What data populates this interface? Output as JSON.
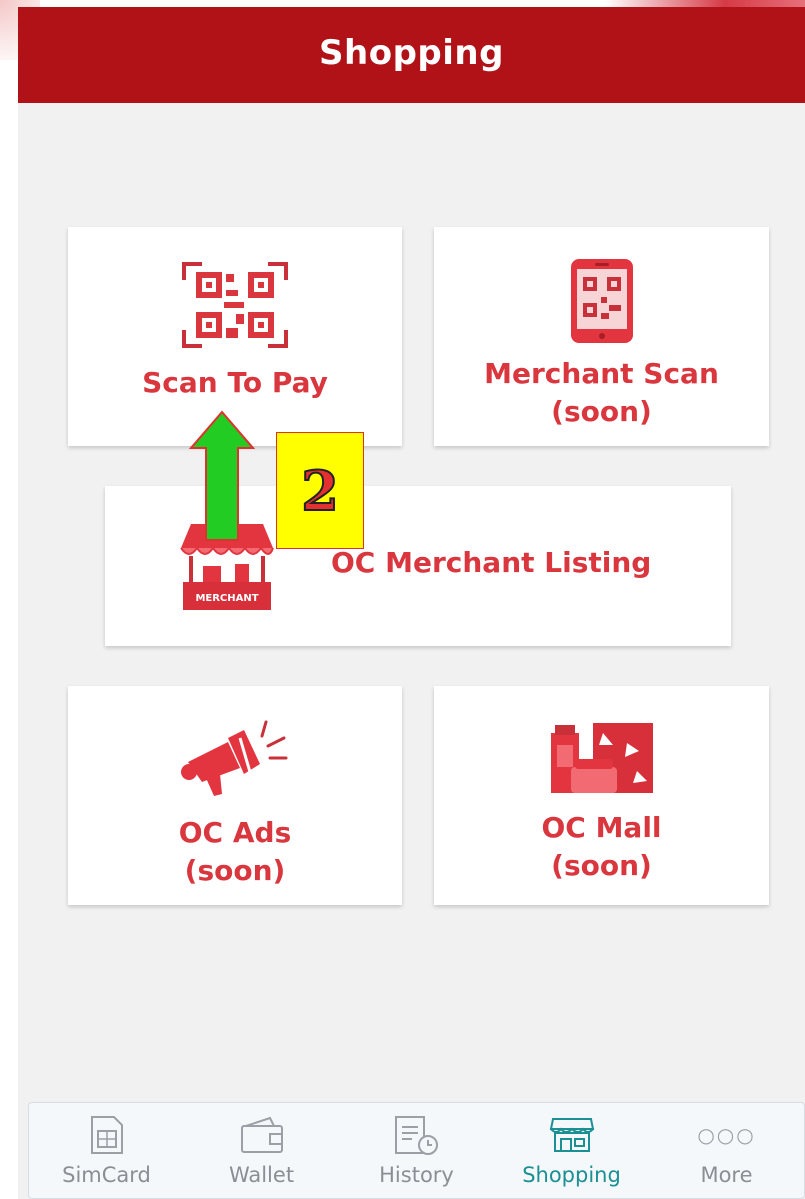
{
  "header": {
    "title": "Shopping"
  },
  "cards": {
    "scan_to_pay": {
      "label": "Scan To Pay",
      "icon": "qr-scan-icon"
    },
    "merchant_scan": {
      "label": "Merchant Scan",
      "sub": "(soon)",
      "icon": "phone-qr-icon"
    },
    "merchant_listing": {
      "label": "OC Merchant Listing",
      "icon": "merchant-stall-icon",
      "badge": "MERCHANT"
    },
    "ads": {
      "label": "OC Ads",
      "sub": "(soon)",
      "icon": "megaphone-icon"
    },
    "mall": {
      "label": "OC Mall",
      "sub": "(soon)",
      "icon": "products-icon"
    }
  },
  "annotation": {
    "number": "2"
  },
  "nav": {
    "items": [
      {
        "label": "SimCard",
        "icon": "sim-card-icon"
      },
      {
        "label": "Wallet",
        "icon": "wallet-icon"
      },
      {
        "label": "History",
        "icon": "history-icon"
      },
      {
        "label": "Shopping",
        "icon": "shop-icon",
        "active": true
      },
      {
        "label": "More",
        "icon": "more-icon",
        "glyph": "○○○"
      }
    ]
  },
  "colors": {
    "header": "#b01217",
    "accent_red": "#d9363e",
    "active_nav": "#1a8f94",
    "inactive_nav": "#8a8f95",
    "annotation_box": "#ffff00",
    "annotation_arrow": "#22cc22"
  }
}
